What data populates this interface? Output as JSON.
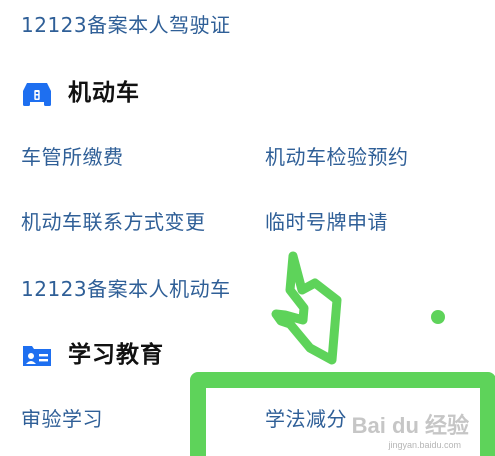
{
  "colors": {
    "link": "#2f5f97",
    "title": "#111111",
    "icon_blue": "#1e6ff0",
    "annotation_green": "#5ed35a"
  },
  "top_item": {
    "label": "12123备案本人驾驶证"
  },
  "motor_vehicle": {
    "icon": "car-icon",
    "title": "机动车",
    "items": [
      {
        "label": "车管所缴费"
      },
      {
        "label": "机动车检验预约"
      },
      {
        "label": "机动车联系方式变更"
      },
      {
        "label": "临时号牌申请"
      },
      {
        "label": "12123备案本人机动车"
      }
    ]
  },
  "education": {
    "icon": "id-card-icon",
    "title": "学习教育",
    "items": [
      {
        "label": "审验学习"
      },
      {
        "label": "学法减分"
      }
    ]
  },
  "watermark": {
    "text": "Bai du 经验",
    "sub": "jingyan.baidu.com"
  }
}
